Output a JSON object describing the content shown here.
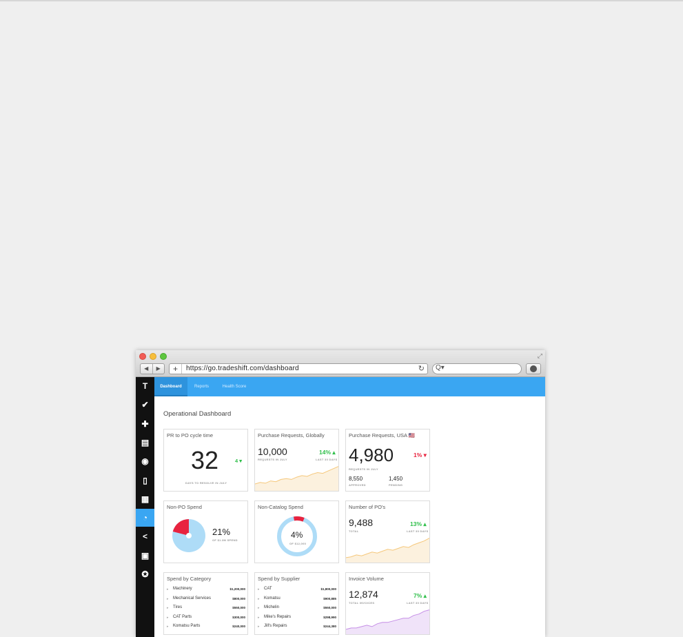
{
  "browser": {
    "url": "https://go.tradeshift.com/dashboard",
    "back_glyph": "◀",
    "forward_glyph": "▶",
    "plus_glyph": "+",
    "reload_glyph": "↻",
    "search_glyph": "Q▾",
    "resize_glyph": "⤢"
  },
  "sidebar": {
    "items": [
      {
        "icon": "tradeshift-logo-icon",
        "glyph": "T"
      },
      {
        "icon": "check-icon",
        "glyph": "✔"
      },
      {
        "icon": "plus-icon",
        "glyph": "✚"
      },
      {
        "icon": "documents-icon",
        "glyph": "▤"
      },
      {
        "icon": "globe-icon",
        "glyph": "◉"
      },
      {
        "icon": "document-icon",
        "glyph": "▯"
      },
      {
        "icon": "apps-grid-icon",
        "glyph": "▦"
      },
      {
        "icon": "pie-chart-icon",
        "glyph": "◔",
        "active": true
      },
      {
        "icon": "share-icon",
        "glyph": "<"
      },
      {
        "icon": "lock-icon",
        "glyph": "▣"
      },
      {
        "icon": "lifebuoy-icon",
        "glyph": "✪"
      }
    ]
  },
  "tabs": [
    {
      "label": "Dashboard",
      "active": true
    },
    {
      "label": "Reports"
    },
    {
      "label": "Health Score"
    }
  ],
  "page_title": "Operational Dashboard",
  "colors": {
    "accent": "#3aa6f2",
    "positive": "#2fbf4a",
    "negative": "#e8233f",
    "area_orange": "#f5c77a",
    "area_purple": "#c58ee6",
    "donut_blue": "#aedcf7"
  },
  "cards": {
    "pr_cycle": {
      "title": "PR to PO cycle time",
      "value": "32",
      "delta": "4 ▾",
      "caption": "DAYS TO RESOLVE IN JULY"
    },
    "pr_global": {
      "title": "Purchase Requests, Globally",
      "value": "10,000",
      "value_caption": "REQUESTS IN JULY",
      "pct": "14% ▴",
      "pct_caption": "LAST 30 DAYS",
      "trend": [
        10,
        12,
        11,
        14,
        13,
        16,
        17,
        16,
        19,
        21,
        20,
        23,
        25,
        24,
        27,
        30,
        33
      ]
    },
    "pr_usa": {
      "title": "Purchase Requests, USA 🇺🇸",
      "value": "4,980",
      "value_caption": "REQUESTS IN JULY",
      "pct": "1% ▾",
      "approved_value": "8,550",
      "approved_label": "APPROVED",
      "pending_value": "1,450",
      "pending_label": "PENDING"
    },
    "non_po": {
      "title": "Non-PO Spend",
      "pct": "21%",
      "caption": "OF $1.3M SPEND",
      "share": 0.21
    },
    "non_catalog": {
      "title": "Non-Catalog Spend",
      "pct": "4%",
      "caption": "OF $12,000",
      "share": 0.04
    },
    "num_po": {
      "title": "Number of PO's",
      "value": "9,488",
      "value_caption": "TOTAL",
      "pct": "13% ▴",
      "pct_caption": "LAST 30 DAYS",
      "trend": [
        6,
        7,
        9,
        8,
        10,
        12,
        11,
        13,
        15,
        14,
        16,
        18,
        17,
        20,
        22,
        24,
        27
      ]
    },
    "spend_category": {
      "title": "Spend by Category",
      "rows": [
        {
          "name": "Machinery",
          "value": "$1,200,000"
        },
        {
          "name": "Mechanical Services",
          "value": "$800,000"
        },
        {
          "name": "Tires",
          "value": "$550,000"
        },
        {
          "name": "CAT Parts",
          "value": "$300,000"
        },
        {
          "name": "Komatsu Parts",
          "value": "$240,000"
        }
      ]
    },
    "spend_supplier": {
      "title": "Spend by Supplier",
      "rows": [
        {
          "name": "CAT",
          "value": "$1,800,000"
        },
        {
          "name": "Komatsu",
          "value": "$900,885"
        },
        {
          "name": "Michelin",
          "value": "$550,000"
        },
        {
          "name": "Mike's Repairs",
          "value": "$298,990"
        },
        {
          "name": "Jill's Repairs",
          "value": "$244,380"
        }
      ]
    },
    "invoice_volume": {
      "title": "Invoice Volume",
      "value": "12,874",
      "value_caption": "TOTAL INVOICES",
      "pct": "7% ▴",
      "pct_caption": "LAST 30 DAYS",
      "trend": [
        4,
        5,
        5,
        6,
        7,
        6,
        8,
        9,
        9,
        10,
        11,
        12,
        12,
        14,
        15,
        17,
        18
      ]
    }
  }
}
